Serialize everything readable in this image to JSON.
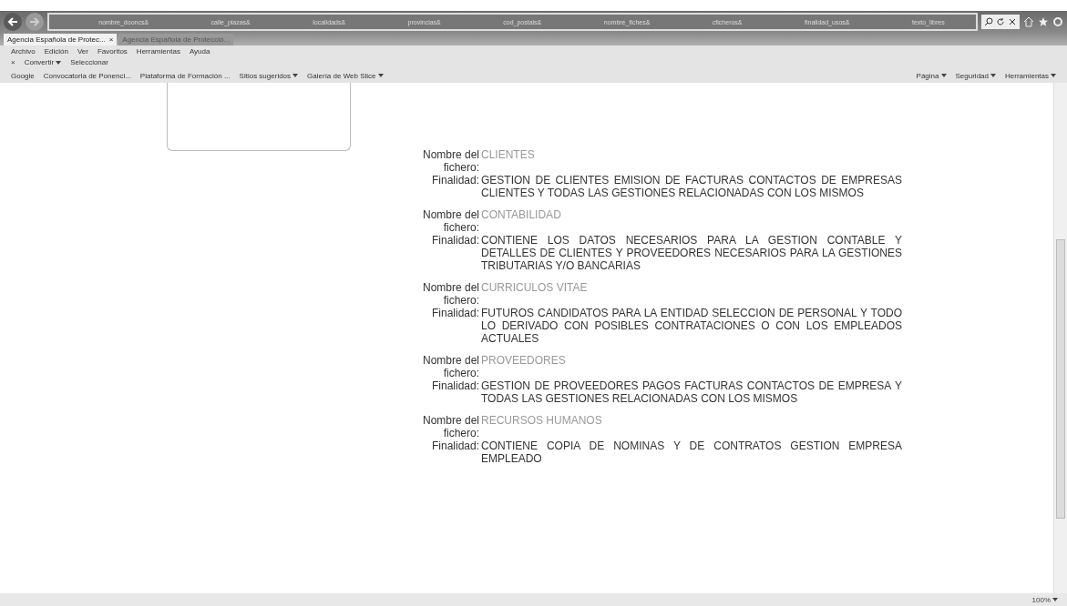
{
  "address_bar": {
    "params": [
      "nombre_dooncs&",
      "calle_plazas&",
      "localidads&",
      "provincias&",
      "cod_postals&",
      "nombre_fiches&",
      "cficheros&",
      "finalidad_usos&",
      "texto_libres"
    ]
  },
  "tabs": [
    {
      "label": "Agencia Española de Protec...",
      "close": "×",
      "selected": true
    },
    {
      "label": "Agencia Española de Protecció...",
      "selected": false
    }
  ],
  "menu": [
    "Archivo",
    "Edición",
    "Ver",
    "Favoritos",
    "Herramientas",
    "Ayuda"
  ],
  "command_bar": {
    "close": "×",
    "convert": "Convertir",
    "select": "Seleccionar"
  },
  "favorites": [
    {
      "label": "Google",
      "menu": false
    },
    {
      "label": "Convocatoria de Ponenci...",
      "menu": false
    },
    {
      "label": "Plataforma de Formación ...",
      "menu": false
    },
    {
      "label": "Sitios sugeridos",
      "menu": true
    },
    {
      "label": "Galería de Web Slice",
      "menu": true
    }
  ],
  "page_tools": [
    {
      "label": "Página"
    },
    {
      "label": "Seguridad"
    },
    {
      "label": "Herramientas"
    }
  ],
  "records": [
    {
      "name_label": "Nombre del",
      "name_label_2": "fichero:",
      "name": "CLIENTES",
      "purpose_label": "Finalidad:",
      "purpose": "GESTION DE CLIENTES EMISION DE FACTURAS CONTACTOS DE EMPRESAS CLIENTES Y TODAS LAS GESTIONES RELACIONADAS CON LOS MISMOS"
    },
    {
      "name_label": "Nombre del",
      "name_label_2": "fichero:",
      "name": "CONTABILIDAD",
      "purpose_label": "Finalidad:",
      "purpose": "CONTIENE LOS DATOS NECESARIOS PARA LA GESTION CONTABLE Y DETALLES DE CLIENTES Y PROVEEDORES NECESARIOS PARA LA GESTIONES TRIBUTARIAS Y/O BANCARIAS"
    },
    {
      "name_label": "Nombre del",
      "name_label_2": "fichero:",
      "name": "CURRICULOS VITAE",
      "purpose_label": "Finalidad:",
      "purpose": "FUTUROS CANDIDATOS PARA LA ENTIDAD SELECCION DE PERSONAL Y TODO LO DERIVADO CON POSIBLES CONTRATACIONES O CON LOS EMPLEADOS ACTUALES"
    },
    {
      "name_label": "Nombre del",
      "name_label_2": "fichero:",
      "name": "PROVEEDORES",
      "purpose_label": "Finalidad:",
      "purpose": "GESTION DE PROVEEDORES PAGOS FACTURAS CONTACTOS DE EMPRESA Y TODAS LAS GESTIONES RELACIONADAS CON LOS MISMOS"
    },
    {
      "name_label": "Nombre del",
      "name_label_2": "fichero:",
      "name": "RECURSOS HUMANOS",
      "purpose_label": "Finalidad:",
      "purpose": "CONTIENE COPIA DE NOMINAS Y DE CONTRATOS GESTION EMPRESA EMPLEADO"
    }
  ],
  "status_bar": {
    "zoom": "100%"
  }
}
